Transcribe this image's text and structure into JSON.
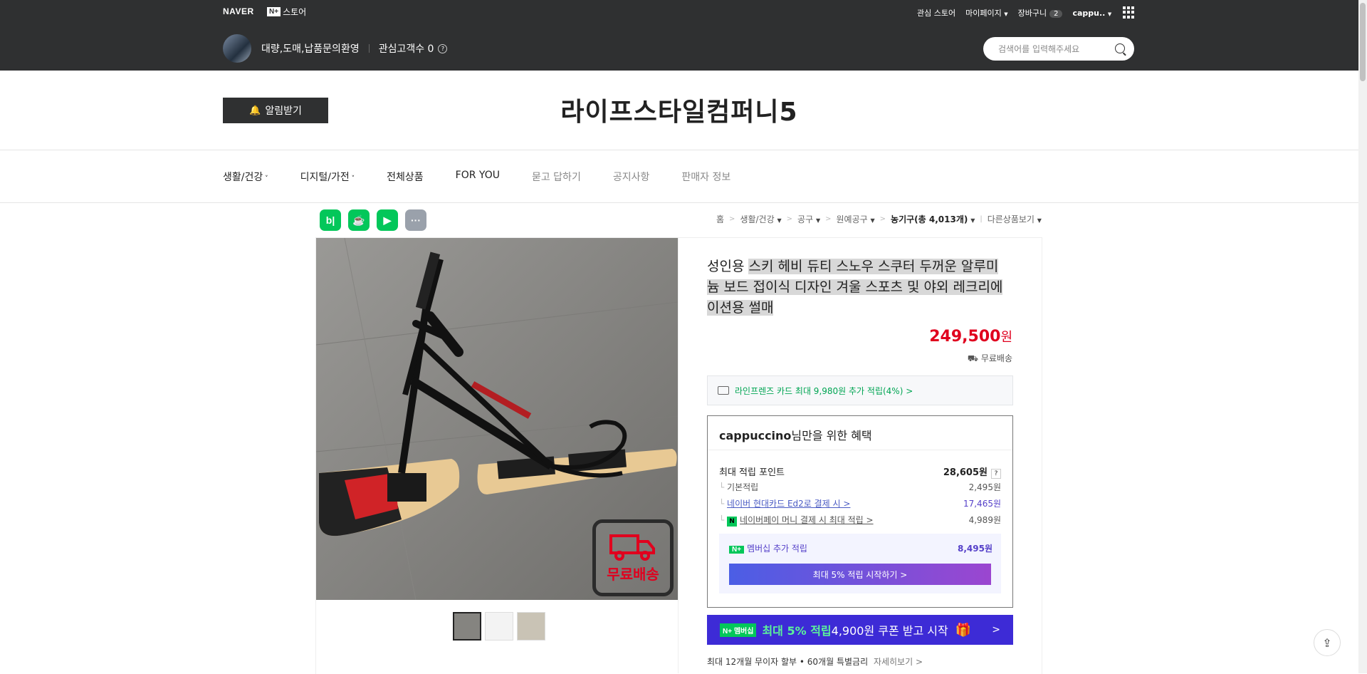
{
  "topbar": {
    "naver": "NAVER",
    "nstore_box": "N+",
    "nstore_text": "스토어",
    "links": [
      "관심 스토어",
      "마이페이지",
      "장바구니",
      "cappu.."
    ],
    "cart_count": "2"
  },
  "store": {
    "tagline": "대량,도매,납품문의환영",
    "followers_label": "관심고객수 0",
    "name": "라이프스타일컴퍼니5",
    "alert_label": "알림받기"
  },
  "search": {
    "placeholder": "검색어를 입력해주세요"
  },
  "nav": {
    "items": [
      "생활/건강",
      "디지털/가전",
      "전체상품",
      "FOR YOU",
      "묻고 답하기",
      "공지사항",
      "판매자 정보"
    ]
  },
  "breadcrumb": {
    "items": [
      "홈",
      "생활/건강",
      "공구",
      "원예공구",
      "농기구(총 4,013개)",
      "다른상품보기"
    ]
  },
  "product": {
    "title_part1": "성인용 ",
    "title_part2": "스키 헤비 듀티 스노우 스쿠터 두꺼운 알루미늄 보드 접이식 디자인 겨울 스포츠 및 야외 레크리에이션용 썰매",
    "price": "249,500",
    "currency": "원",
    "shipping": "무료배송",
    "free_badge": "무료배송",
    "card_offer": "라인프렌즈 카드 최대 9,980원 추가 적립(4%) >"
  },
  "benefit": {
    "user": "cappuccino",
    "title_suffix": "님만을 위한 혜택",
    "max_points_label": "최대 적립 포인트",
    "max_points_value": "28,605원",
    "rows": [
      {
        "label": "기본적립",
        "value": "2,495원"
      },
      {
        "label": "네이버 현대카드 Ed2로 결제 시 >",
        "value": "17,465원"
      },
      {
        "label": "네이버페이 머니 결제 시 최대 적립 >",
        "value": "4,989원"
      }
    ],
    "membership_label": "멤버십 추가 적립",
    "membership_value": "8,495원",
    "membership_button": "최대 5% 적립 시작하기 >"
  },
  "banner": {
    "pill": "N+ 멤버십",
    "highlight": "최대 5% 적립",
    "text": " 4,900원 쿠폰 받고 시작"
  },
  "finance": {
    "text": "최대 12개월 무이자 할부 • 60개월 특별금리",
    "more": "자세히보기 >"
  }
}
